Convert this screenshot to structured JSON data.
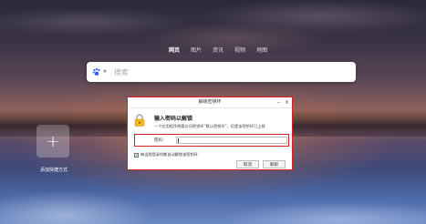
{
  "nav": {
    "items": [
      "网页",
      "图片",
      "资讯",
      "视频",
      "地图"
    ],
    "active_index": 0
  },
  "search": {
    "placeholder": "搜索",
    "engine_icon": "baidu-paw-icon",
    "accent": "#3385ff"
  },
  "shortcut": {
    "icon": "plus-icon",
    "label": "添加快捷方式"
  },
  "dialog": {
    "title": "解锁密钥环",
    "heading": "输入密码以解锁",
    "description": "一个应用程序想要访问密钥环“默认密钥环”，但是该密钥环已上锁",
    "password_label": "密码：",
    "password_value": "",
    "checkbox_label": "每当我登录时都自动解锁该密钥环",
    "checkbox_checked": true,
    "cancel_label": "取消",
    "unlock_label": "解锁",
    "highlight_color": "#d32020"
  }
}
